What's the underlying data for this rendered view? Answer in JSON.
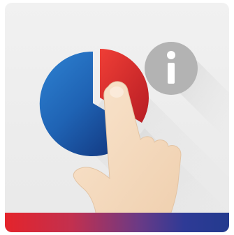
{
  "tile": {
    "icon": "info-icon",
    "accent_colors": {
      "pie_blue": "#1f63b4",
      "pie_blue_dark": "#0f2d73",
      "pie_red": "#e3262b",
      "info_gray": "#b3b3b3",
      "hand_skin": "#f6dcc1",
      "bar_start": "#e4242b",
      "bar_end": "#233a8e"
    }
  }
}
